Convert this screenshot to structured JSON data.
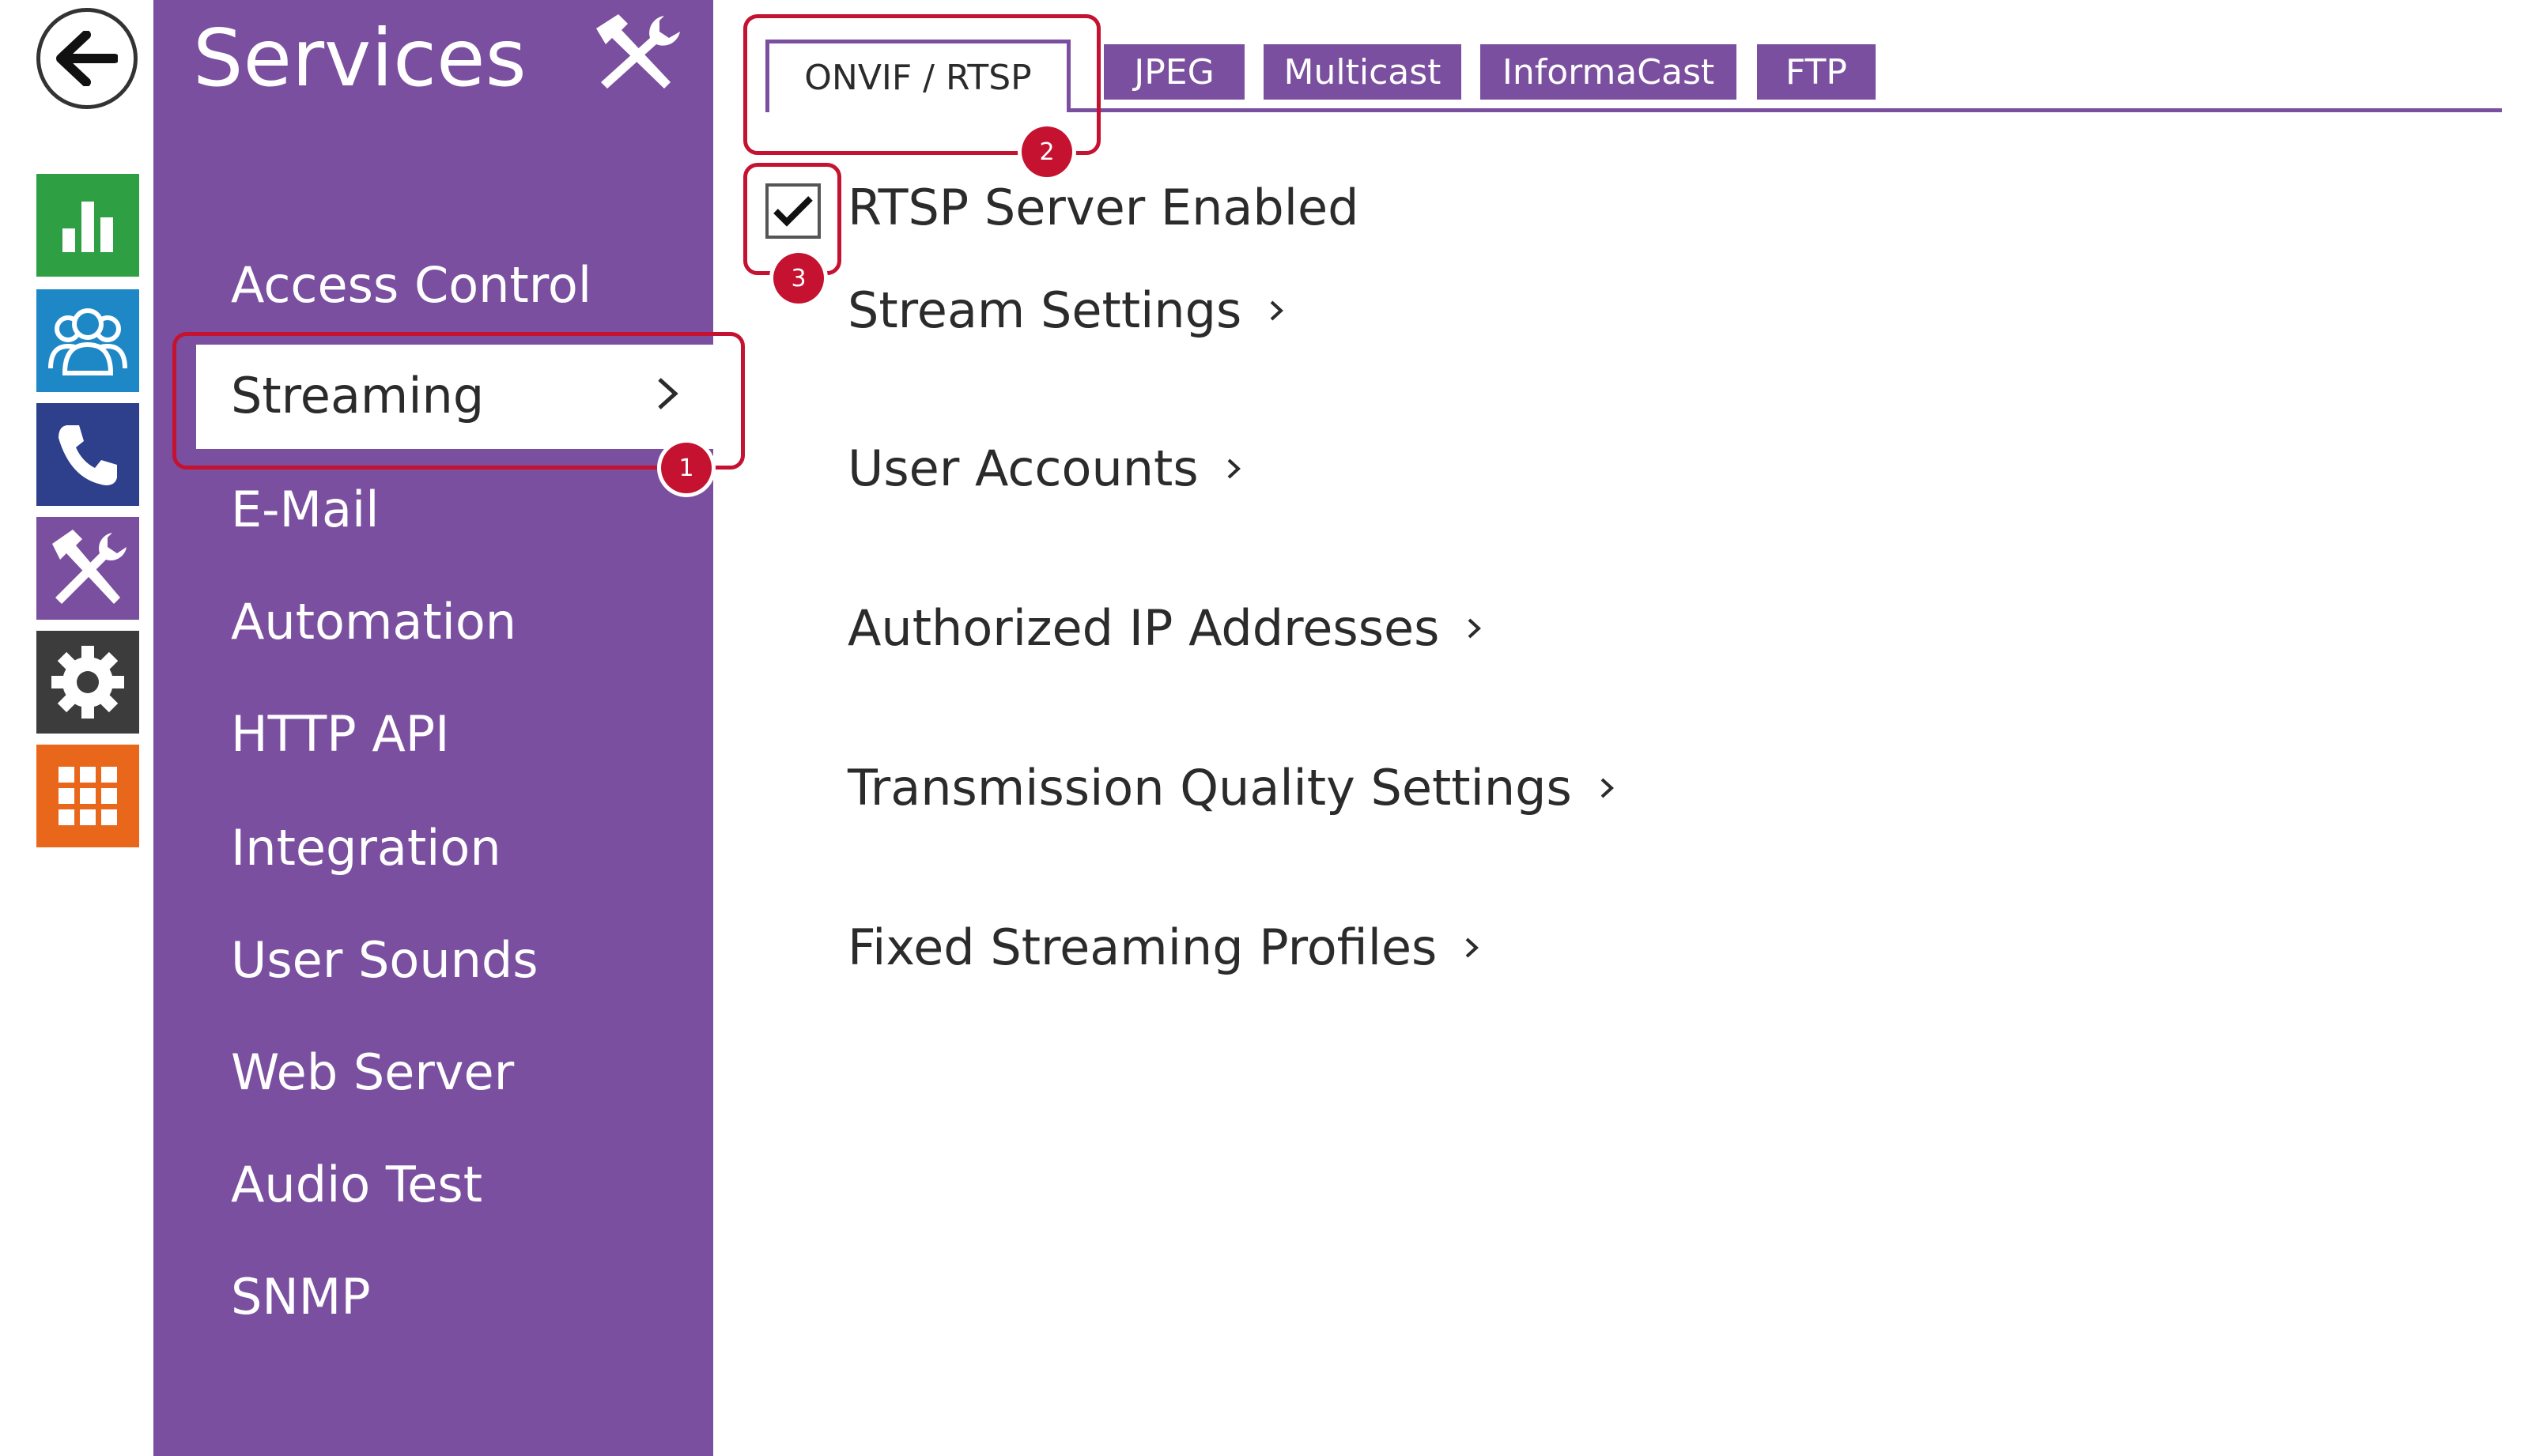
{
  "sidebar": {
    "title": "Services",
    "active_item": "Streaming",
    "items": [
      "Access Control",
      "E-Mail",
      "Automation",
      "HTTP API",
      "Integration",
      "User Sounds",
      "Web Server",
      "Audio Test",
      "SNMP"
    ]
  },
  "rail": {
    "tiles": [
      {
        "icon": "bar-chart-icon",
        "color": "#2ea043"
      },
      {
        "icon": "users-icon",
        "color": "#1e88c7"
      },
      {
        "icon": "phone-icon",
        "color": "#2e3f8c"
      },
      {
        "icon": "tools-icon",
        "color": "#7b4f9f"
      },
      {
        "icon": "gear-icon",
        "color": "#3c3c3c"
      },
      {
        "icon": "grid-icon",
        "color": "#e8671a"
      }
    ]
  },
  "tabs": [
    "ONVIF / RTSP",
    "JPEG",
    "Multicast",
    "InformaCast",
    "FTP"
  ],
  "content": {
    "rtsp_enabled_label": "RTSP Server Enabled",
    "rtsp_enabled": true,
    "links": [
      "Stream Settings",
      "User Accounts",
      "Authorized IP Addresses",
      "Transmission Quality Settings",
      "Fixed Streaming Profiles"
    ]
  },
  "callouts": [
    "1",
    "2",
    "3"
  ],
  "colors": {
    "accent": "#7b4f9f",
    "callout": "#c41230"
  }
}
